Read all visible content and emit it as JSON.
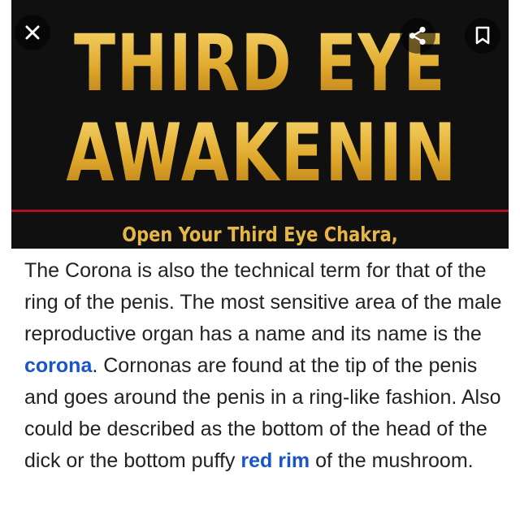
{
  "hero": {
    "title_line1": "THIRD EYE",
    "title_line2": "AWAKENING",
    "subtitle": "Open Your Third Eye Chakra,"
  },
  "controls": {
    "close_icon": "close-icon",
    "share_icon": "share-icon",
    "bookmark_icon": "bookmark-icon"
  },
  "article": {
    "sentence1": "The Corona is also the technical term for that of the ring of the penis. The most sensitive area of the male reproductive organ has a name and its name is the ",
    "link1": "corona",
    "sentence2": ". Cornonas are found at the tip of the penis and goes around the penis in a ring-like fashion. Also could be described as the bottom of the head of the dick or the bottom puffy ",
    "link2": "red rim",
    "sentence3": " of the mushroom."
  },
  "colors": {
    "gold": "#e8b93c",
    "hero_background": "#101010",
    "rule": "#b4121a",
    "link": "#1a55c8",
    "text": "#222222"
  }
}
